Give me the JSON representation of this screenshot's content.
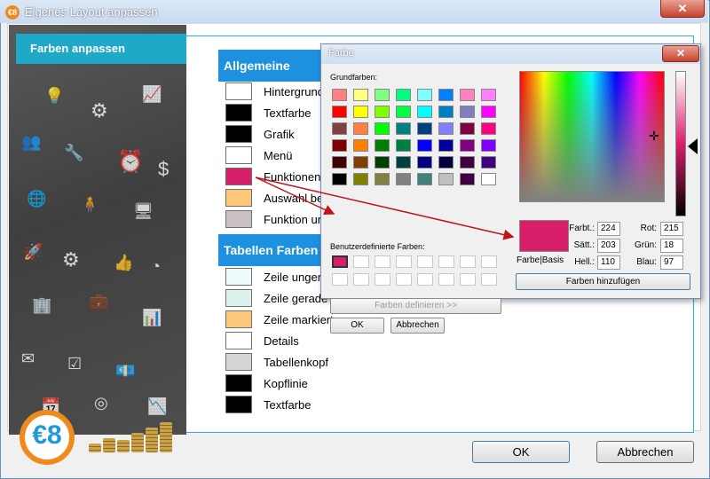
{
  "window": {
    "title": "Eigenes Layout anpassen",
    "app_icon_text": "€8",
    "close_label": "✕"
  },
  "sidebar": {
    "tab_label": "Farben anpassen",
    "logo_text": "€8"
  },
  "general": {
    "header": "Allgemeine Farben",
    "rows": [
      {
        "label": "Hintergrund",
        "color": "#ffffff"
      },
      {
        "label": "Textfarbe",
        "color": "#000000"
      },
      {
        "label": "Grafik",
        "color": "#000000"
      },
      {
        "label": "Menü",
        "color": "#ffffff"
      },
      {
        "label": "Funktionen",
        "color": "#d81f6a"
      },
      {
        "label": "Auswahl be",
        "color": "#fcc779"
      },
      {
        "label": "Funktion un",
        "color": "#cbbfc6"
      }
    ]
  },
  "tables": {
    "header": "Tabellen Farben",
    "rows": [
      {
        "label": "Zeile ungera",
        "color": "#f0fbfb"
      },
      {
        "label": "Zeile gerade",
        "color": "#dcf2ee"
      },
      {
        "label": "Zeile markiert",
        "color": "#fcc779"
      },
      {
        "label": "Details",
        "color": "#ffffff"
      },
      {
        "label": "Tabellenkopf",
        "color": "#d4d4d4"
      },
      {
        "label": "Kopflinie",
        "color": "#000000"
      },
      {
        "label": "Textfarbe",
        "color": "#000000"
      }
    ]
  },
  "buttons": {
    "ok": "OK",
    "cancel": "Abbrechen"
  },
  "color_dialog": {
    "title": "Farbe",
    "close_label": "✕",
    "basic_label": "Grundfarben:",
    "custom_label": "Benutzerdefinierte Farben:",
    "define_button": "Farben definieren >>",
    "ok": "OK",
    "cancel": "Abbrechen",
    "add_button": "Farben hinzufügen",
    "preview_label": "Farbe|Basis",
    "preview_color": "#d81f6a",
    "custom_first_color": "#d81f6a",
    "fields": {
      "hue": {
        "label": "Farbt.:",
        "value": "224"
      },
      "sat": {
        "label": "Sätt.:",
        "value": "203"
      },
      "lum": {
        "label": "Hell.:",
        "value": "110"
      },
      "red": {
        "label": "Rot:",
        "value": "215"
      },
      "green": {
        "label": "Grün:",
        "value": "18"
      },
      "blue": {
        "label": "Blau:",
        "value": "97"
      }
    },
    "basic_colors": [
      "#ff8080",
      "#ffff80",
      "#80ff80",
      "#00ff80",
      "#80ffff",
      "#0080ff",
      "#ff80c0",
      "#ff80ff",
      "#ff0000",
      "#ffff00",
      "#80ff00",
      "#00ff40",
      "#00ffff",
      "#0080c0",
      "#8080c0",
      "#ff00ff",
      "#804040",
      "#ff8040",
      "#00ff00",
      "#008080",
      "#004080",
      "#8080ff",
      "#800040",
      "#ff0080",
      "#800000",
      "#ff8000",
      "#008000",
      "#008040",
      "#0000ff",
      "#0000a0",
      "#800080",
      "#8000ff",
      "#400000",
      "#804000",
      "#004000",
      "#004040",
      "#000080",
      "#000040",
      "#400040",
      "#400080",
      "#000000",
      "#808000",
      "#808040",
      "#808080",
      "#408080",
      "#c0c0c0",
      "#400040",
      "#ffffff"
    ]
  }
}
